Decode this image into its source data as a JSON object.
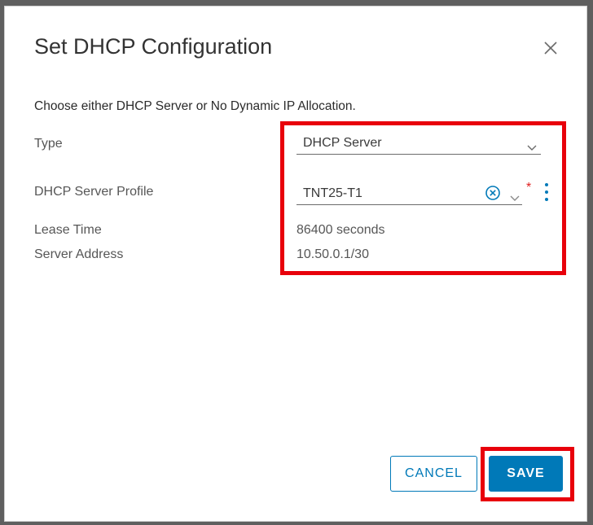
{
  "dialog": {
    "title": "Set DHCP Configuration",
    "instruction": "Choose either DHCP Server or No Dynamic IP Allocation."
  },
  "form": {
    "type_label": "Type",
    "type_value": "DHCP Server",
    "profile_label": "DHCP Server Profile",
    "profile_value": "TNT25-T1",
    "required_marker": "*",
    "lease_label": "Lease Time",
    "lease_value": "86400 seconds",
    "address_label": "Server Address",
    "address_value": "10.50.0.1/30"
  },
  "buttons": {
    "cancel_label": "CANCEL",
    "save_label": "SAVE"
  },
  "colors": {
    "accent": "#0079b8",
    "highlight": "#e8000b",
    "required": "#e02020"
  },
  "icons": [
    "close-icon",
    "chevron-down-icon",
    "clear-circle-icon",
    "kebab-menu-icon"
  ]
}
